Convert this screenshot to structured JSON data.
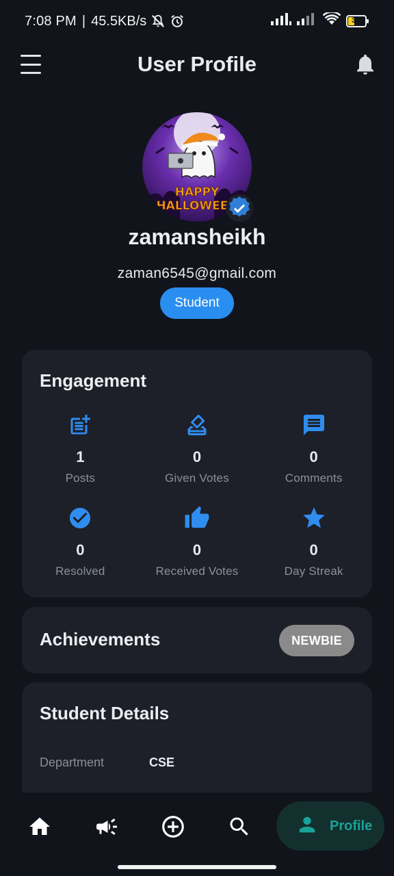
{
  "status_bar": {
    "time": "7:08 PM",
    "separator": "|",
    "net_speed": "45.5KB/s",
    "battery_level": "31",
    "icons": [
      "mute-bell-icon",
      "alarm-icon",
      "signal-icon",
      "signal-icon",
      "wifi-icon",
      "battery-icon"
    ]
  },
  "app_bar": {
    "title": "User Profile",
    "left_icon": "menu-icon",
    "right_icon": "bell-icon"
  },
  "profile": {
    "avatar_caption_line1": "HAPPY",
    "avatar_caption_line2": "HALLOWEEN",
    "username": "zamansheikh",
    "email": "zaman6545@gmail.com",
    "role": "Student",
    "verified_icon": "verified-check-icon"
  },
  "engagement": {
    "title": "Engagement",
    "stats": [
      {
        "icon": "post-add-icon",
        "value": "1",
        "label": "Posts"
      },
      {
        "icon": "ballot-vote-icon",
        "value": "0",
        "label": "Given Votes"
      },
      {
        "icon": "comment-icon",
        "value": "0",
        "label": "Comments"
      },
      {
        "icon": "check-circle-icon",
        "value": "0",
        "label": "Resolved"
      },
      {
        "icon": "thumb-up-icon",
        "value": "0",
        "label": "Received Votes"
      },
      {
        "icon": "star-icon",
        "value": "0",
        "label": "Day Streak"
      }
    ]
  },
  "achievements": {
    "title": "Achievements",
    "badge": "NEWBIE"
  },
  "student_details": {
    "title": "Student Details",
    "rows": [
      {
        "key": "Department",
        "value": "CSE"
      }
    ]
  },
  "bottom_nav": {
    "items": [
      {
        "icon": "home-icon"
      },
      {
        "icon": "megaphone-icon"
      },
      {
        "icon": "add-circle-icon"
      },
      {
        "icon": "search-icon"
      },
      {
        "icon": "person-icon",
        "label": "Profile",
        "active": true
      }
    ]
  },
  "colors": {
    "background": "#11141b",
    "card": "#1d2028",
    "accent_blue": "#2a8ef0",
    "icon_blue": "#2f8df0",
    "nav_active_bg": "#13302f",
    "nav_active_fg": "#19a398",
    "badge_gray": "#8a8a8a"
  }
}
